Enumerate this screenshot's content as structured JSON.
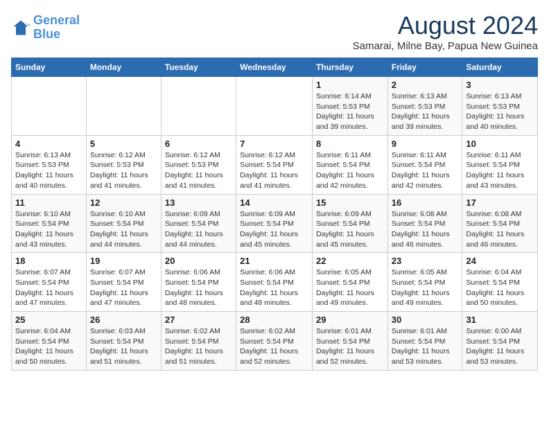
{
  "header": {
    "logo_line1": "General",
    "logo_line2": "Blue",
    "month_year": "August 2024",
    "location": "Samarai, Milne Bay, Papua New Guinea"
  },
  "weekdays": [
    "Sunday",
    "Monday",
    "Tuesday",
    "Wednesday",
    "Thursday",
    "Friday",
    "Saturday"
  ],
  "weeks": [
    [
      {
        "day": "",
        "info": ""
      },
      {
        "day": "",
        "info": ""
      },
      {
        "day": "",
        "info": ""
      },
      {
        "day": "",
        "info": ""
      },
      {
        "day": "1",
        "info": "Sunrise: 6:14 AM\nSunset: 5:53 PM\nDaylight: 11 hours\nand 39 minutes."
      },
      {
        "day": "2",
        "info": "Sunrise: 6:13 AM\nSunset: 5:53 PM\nDaylight: 11 hours\nand 39 minutes."
      },
      {
        "day": "3",
        "info": "Sunrise: 6:13 AM\nSunset: 5:53 PM\nDaylight: 11 hours\nand 40 minutes."
      }
    ],
    [
      {
        "day": "4",
        "info": "Sunrise: 6:13 AM\nSunset: 5:53 PM\nDaylight: 11 hours\nand 40 minutes."
      },
      {
        "day": "5",
        "info": "Sunrise: 6:12 AM\nSunset: 5:53 PM\nDaylight: 11 hours\nand 41 minutes."
      },
      {
        "day": "6",
        "info": "Sunrise: 6:12 AM\nSunset: 5:53 PM\nDaylight: 11 hours\nand 41 minutes."
      },
      {
        "day": "7",
        "info": "Sunrise: 6:12 AM\nSunset: 5:54 PM\nDaylight: 11 hours\nand 41 minutes."
      },
      {
        "day": "8",
        "info": "Sunrise: 6:11 AM\nSunset: 5:54 PM\nDaylight: 11 hours\nand 42 minutes."
      },
      {
        "day": "9",
        "info": "Sunrise: 6:11 AM\nSunset: 5:54 PM\nDaylight: 11 hours\nand 42 minutes."
      },
      {
        "day": "10",
        "info": "Sunrise: 6:11 AM\nSunset: 5:54 PM\nDaylight: 11 hours\nand 43 minutes."
      }
    ],
    [
      {
        "day": "11",
        "info": "Sunrise: 6:10 AM\nSunset: 5:54 PM\nDaylight: 11 hours\nand 43 minutes."
      },
      {
        "day": "12",
        "info": "Sunrise: 6:10 AM\nSunset: 5:54 PM\nDaylight: 11 hours\nand 44 minutes."
      },
      {
        "day": "13",
        "info": "Sunrise: 6:09 AM\nSunset: 5:54 PM\nDaylight: 11 hours\nand 44 minutes."
      },
      {
        "day": "14",
        "info": "Sunrise: 6:09 AM\nSunset: 5:54 PM\nDaylight: 11 hours\nand 45 minutes."
      },
      {
        "day": "15",
        "info": "Sunrise: 6:09 AM\nSunset: 5:54 PM\nDaylight: 11 hours\nand 45 minutes."
      },
      {
        "day": "16",
        "info": "Sunrise: 6:08 AM\nSunset: 5:54 PM\nDaylight: 11 hours\nand 46 minutes."
      },
      {
        "day": "17",
        "info": "Sunrise: 6:08 AM\nSunset: 5:54 PM\nDaylight: 11 hours\nand 46 minutes."
      }
    ],
    [
      {
        "day": "18",
        "info": "Sunrise: 6:07 AM\nSunset: 5:54 PM\nDaylight: 11 hours\nand 47 minutes."
      },
      {
        "day": "19",
        "info": "Sunrise: 6:07 AM\nSunset: 5:54 PM\nDaylight: 11 hours\nand 47 minutes."
      },
      {
        "day": "20",
        "info": "Sunrise: 6:06 AM\nSunset: 5:54 PM\nDaylight: 11 hours\nand 48 minutes."
      },
      {
        "day": "21",
        "info": "Sunrise: 6:06 AM\nSunset: 5:54 PM\nDaylight: 11 hours\nand 48 minutes."
      },
      {
        "day": "22",
        "info": "Sunrise: 6:05 AM\nSunset: 5:54 PM\nDaylight: 11 hours\nand 49 minutes."
      },
      {
        "day": "23",
        "info": "Sunrise: 6:05 AM\nSunset: 5:54 PM\nDaylight: 11 hours\nand 49 minutes."
      },
      {
        "day": "24",
        "info": "Sunrise: 6:04 AM\nSunset: 5:54 PM\nDaylight: 11 hours\nand 50 minutes."
      }
    ],
    [
      {
        "day": "25",
        "info": "Sunrise: 6:04 AM\nSunset: 5:54 PM\nDaylight: 11 hours\nand 50 minutes."
      },
      {
        "day": "26",
        "info": "Sunrise: 6:03 AM\nSunset: 5:54 PM\nDaylight: 11 hours\nand 51 minutes."
      },
      {
        "day": "27",
        "info": "Sunrise: 6:02 AM\nSunset: 5:54 PM\nDaylight: 11 hours\nand 51 minutes."
      },
      {
        "day": "28",
        "info": "Sunrise: 6:02 AM\nSunset: 5:54 PM\nDaylight: 11 hours\nand 52 minutes."
      },
      {
        "day": "29",
        "info": "Sunrise: 6:01 AM\nSunset: 5:54 PM\nDaylight: 11 hours\nand 52 minutes."
      },
      {
        "day": "30",
        "info": "Sunrise: 6:01 AM\nSunset: 5:54 PM\nDaylight: 11 hours\nand 53 minutes."
      },
      {
        "day": "31",
        "info": "Sunrise: 6:00 AM\nSunset: 5:54 PM\nDaylight: 11 hours\nand 53 minutes."
      }
    ]
  ]
}
